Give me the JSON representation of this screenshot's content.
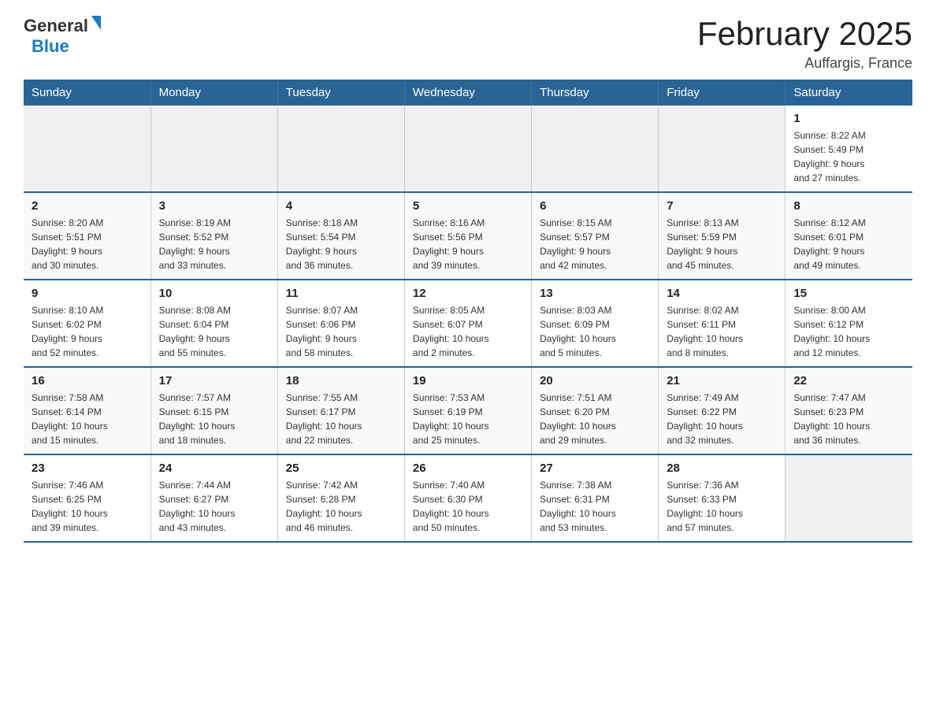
{
  "header": {
    "logo_general": "General",
    "logo_blue": "Blue",
    "title": "February 2025",
    "location": "Auffargis, France"
  },
  "days_of_week": [
    "Sunday",
    "Monday",
    "Tuesday",
    "Wednesday",
    "Thursday",
    "Friday",
    "Saturday"
  ],
  "weeks": [
    [
      {
        "day": "",
        "info": ""
      },
      {
        "day": "",
        "info": ""
      },
      {
        "day": "",
        "info": ""
      },
      {
        "day": "",
        "info": ""
      },
      {
        "day": "",
        "info": ""
      },
      {
        "day": "",
        "info": ""
      },
      {
        "day": "1",
        "info": "Sunrise: 8:22 AM\nSunset: 5:49 PM\nDaylight: 9 hours\nand 27 minutes."
      }
    ],
    [
      {
        "day": "2",
        "info": "Sunrise: 8:20 AM\nSunset: 5:51 PM\nDaylight: 9 hours\nand 30 minutes."
      },
      {
        "day": "3",
        "info": "Sunrise: 8:19 AM\nSunset: 5:52 PM\nDaylight: 9 hours\nand 33 minutes."
      },
      {
        "day": "4",
        "info": "Sunrise: 8:18 AM\nSunset: 5:54 PM\nDaylight: 9 hours\nand 36 minutes."
      },
      {
        "day": "5",
        "info": "Sunrise: 8:16 AM\nSunset: 5:56 PM\nDaylight: 9 hours\nand 39 minutes."
      },
      {
        "day": "6",
        "info": "Sunrise: 8:15 AM\nSunset: 5:57 PM\nDaylight: 9 hours\nand 42 minutes."
      },
      {
        "day": "7",
        "info": "Sunrise: 8:13 AM\nSunset: 5:59 PM\nDaylight: 9 hours\nand 45 minutes."
      },
      {
        "day": "8",
        "info": "Sunrise: 8:12 AM\nSunset: 6:01 PM\nDaylight: 9 hours\nand 49 minutes."
      }
    ],
    [
      {
        "day": "9",
        "info": "Sunrise: 8:10 AM\nSunset: 6:02 PM\nDaylight: 9 hours\nand 52 minutes."
      },
      {
        "day": "10",
        "info": "Sunrise: 8:08 AM\nSunset: 6:04 PM\nDaylight: 9 hours\nand 55 minutes."
      },
      {
        "day": "11",
        "info": "Sunrise: 8:07 AM\nSunset: 6:06 PM\nDaylight: 9 hours\nand 58 minutes."
      },
      {
        "day": "12",
        "info": "Sunrise: 8:05 AM\nSunset: 6:07 PM\nDaylight: 10 hours\nand 2 minutes."
      },
      {
        "day": "13",
        "info": "Sunrise: 8:03 AM\nSunset: 6:09 PM\nDaylight: 10 hours\nand 5 minutes."
      },
      {
        "day": "14",
        "info": "Sunrise: 8:02 AM\nSunset: 6:11 PM\nDaylight: 10 hours\nand 8 minutes."
      },
      {
        "day": "15",
        "info": "Sunrise: 8:00 AM\nSunset: 6:12 PM\nDaylight: 10 hours\nand 12 minutes."
      }
    ],
    [
      {
        "day": "16",
        "info": "Sunrise: 7:58 AM\nSunset: 6:14 PM\nDaylight: 10 hours\nand 15 minutes."
      },
      {
        "day": "17",
        "info": "Sunrise: 7:57 AM\nSunset: 6:15 PM\nDaylight: 10 hours\nand 18 minutes."
      },
      {
        "day": "18",
        "info": "Sunrise: 7:55 AM\nSunset: 6:17 PM\nDaylight: 10 hours\nand 22 minutes."
      },
      {
        "day": "19",
        "info": "Sunrise: 7:53 AM\nSunset: 6:19 PM\nDaylight: 10 hours\nand 25 minutes."
      },
      {
        "day": "20",
        "info": "Sunrise: 7:51 AM\nSunset: 6:20 PM\nDaylight: 10 hours\nand 29 minutes."
      },
      {
        "day": "21",
        "info": "Sunrise: 7:49 AM\nSunset: 6:22 PM\nDaylight: 10 hours\nand 32 minutes."
      },
      {
        "day": "22",
        "info": "Sunrise: 7:47 AM\nSunset: 6:23 PM\nDaylight: 10 hours\nand 36 minutes."
      }
    ],
    [
      {
        "day": "23",
        "info": "Sunrise: 7:46 AM\nSunset: 6:25 PM\nDaylight: 10 hours\nand 39 minutes."
      },
      {
        "day": "24",
        "info": "Sunrise: 7:44 AM\nSunset: 6:27 PM\nDaylight: 10 hours\nand 43 minutes."
      },
      {
        "day": "25",
        "info": "Sunrise: 7:42 AM\nSunset: 6:28 PM\nDaylight: 10 hours\nand 46 minutes."
      },
      {
        "day": "26",
        "info": "Sunrise: 7:40 AM\nSunset: 6:30 PM\nDaylight: 10 hours\nand 50 minutes."
      },
      {
        "day": "27",
        "info": "Sunrise: 7:38 AM\nSunset: 6:31 PM\nDaylight: 10 hours\nand 53 minutes."
      },
      {
        "day": "28",
        "info": "Sunrise: 7:36 AM\nSunset: 6:33 PM\nDaylight: 10 hours\nand 57 minutes."
      },
      {
        "day": "",
        "info": ""
      }
    ]
  ]
}
